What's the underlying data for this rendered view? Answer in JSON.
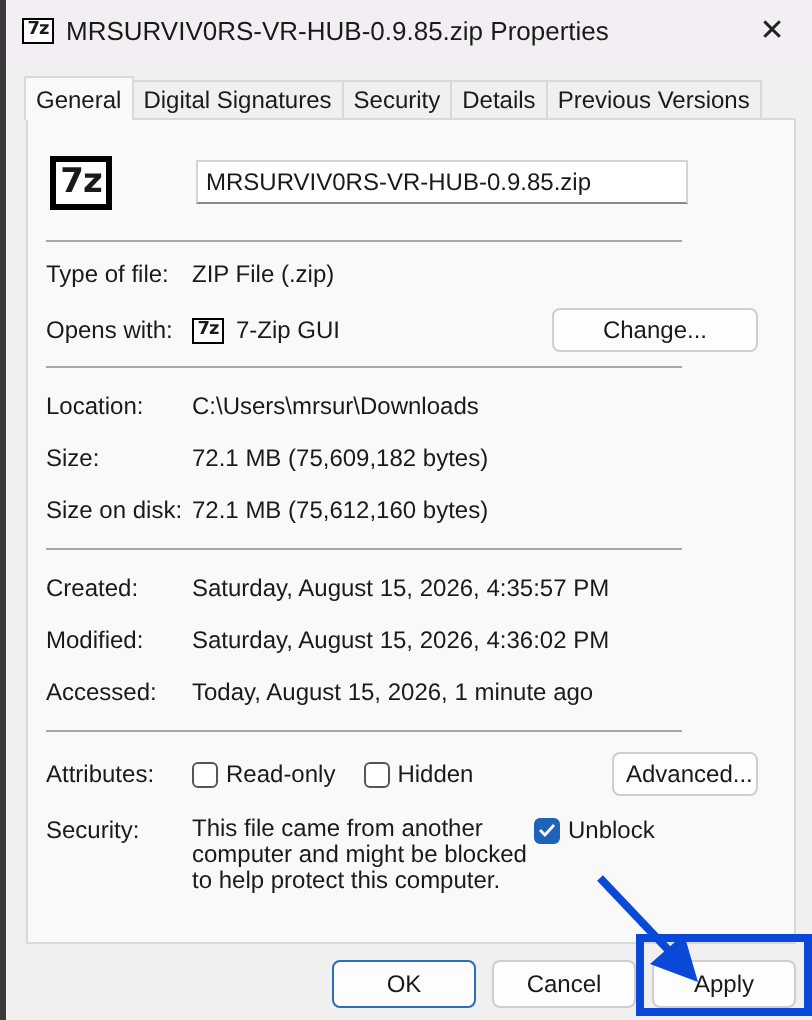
{
  "window": {
    "title": "MRSURVIV0RS-VR-HUB-0.9.85.zip Properties",
    "icon_text": "7z",
    "close": "✕"
  },
  "tabs": [
    {
      "label": "General",
      "selected": true
    },
    {
      "label": "Digital Signatures",
      "selected": false
    },
    {
      "label": "Security",
      "selected": false
    },
    {
      "label": "Details",
      "selected": false
    },
    {
      "label": "Previous Versions",
      "selected": false
    }
  ],
  "file": {
    "icon_text": "7z",
    "name": "MRSURVIV0RS-VR-HUB-0.9.85.zip"
  },
  "type_section": [
    {
      "label": "Type of file:",
      "value": "ZIP File (.zip)"
    },
    {
      "label": "Opens with:",
      "value": "7-Zip GUI",
      "icon_text": "7z",
      "button": "Change..."
    }
  ],
  "location_section": [
    {
      "label": "Location:",
      "value": "C:\\Users\\mrsur\\Downloads"
    },
    {
      "label": "Size:",
      "value": "72.1 MB (75,609,182 bytes)"
    },
    {
      "label": "Size on disk:",
      "value": "72.1 MB (75,612,160 bytes)"
    }
  ],
  "dates_section": [
    {
      "label": "Created:",
      "value": "Saturday, August 15, 2026, 4:35:57 PM"
    },
    {
      "label": "Modified:",
      "value": "Saturday, August 15, 2026, 4:36:02 PM"
    },
    {
      "label": "Accessed:",
      "value": "Today, August 15, 2026, 1 minute ago"
    }
  ],
  "attributes": {
    "label": "Attributes:",
    "checkboxes": [
      {
        "label": "Read-only",
        "checked": false
      },
      {
        "label": "Hidden",
        "checked": false
      }
    ],
    "button": "Advanced..."
  },
  "security": {
    "label": "Security:",
    "text": "This file came from another computer and might be blocked to help protect this computer.",
    "checkbox": {
      "label": "Unblock",
      "checked": true
    }
  },
  "buttons": [
    {
      "label": "OK",
      "default": true
    },
    {
      "label": "Cancel",
      "default": false
    },
    {
      "label": "Apply",
      "default": false
    }
  ]
}
